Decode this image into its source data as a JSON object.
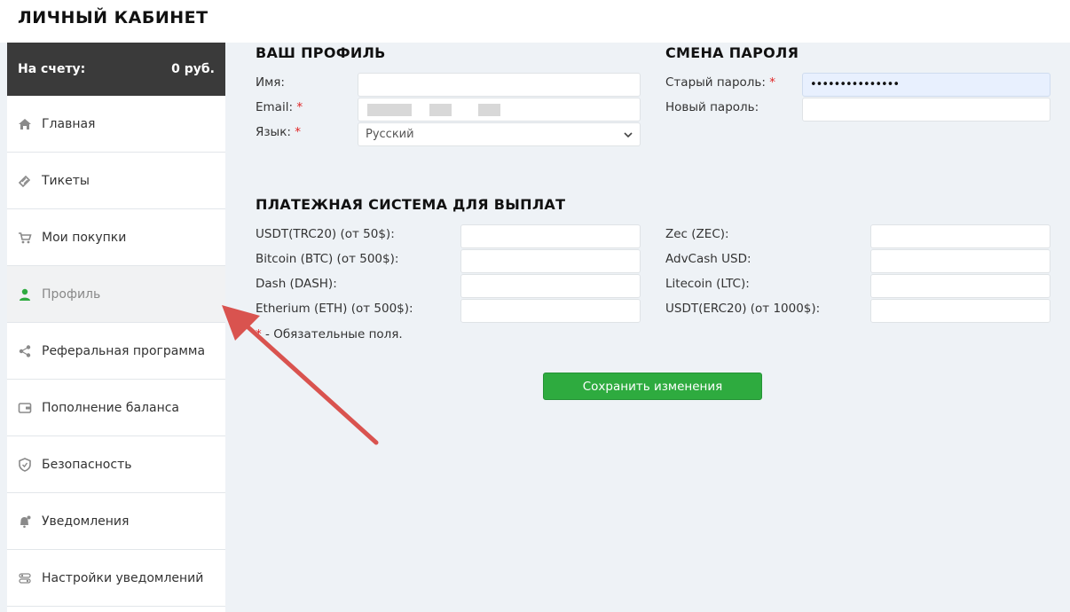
{
  "header": {
    "title": "ЛИЧНЫЙ КАБИНЕТ"
  },
  "balance": {
    "label": "На счету:",
    "value": "0 руб."
  },
  "sidebar": {
    "items": [
      {
        "label": "Главная",
        "icon": "home-icon"
      },
      {
        "label": "Тикеты",
        "icon": "ticket-icon"
      },
      {
        "label": "Мои покупки",
        "icon": "cart-icon"
      },
      {
        "label": "Профиль",
        "icon": "user-icon",
        "active": true
      },
      {
        "label": "Реферальная программа",
        "icon": "share-icon"
      },
      {
        "label": "Пополнение баланса",
        "icon": "wallet-icon"
      },
      {
        "label": "Безопасность",
        "icon": "shield-icon"
      },
      {
        "label": "Уведомления",
        "icon": "bell-icon"
      },
      {
        "label": "Настройки уведомлений",
        "icon": "settings-icon"
      }
    ]
  },
  "profile": {
    "title": "ВАШ ПРОФИЛЬ",
    "name_label": "Имя:",
    "name_value": "",
    "email_label": "Email:",
    "language_label": "Язык:",
    "language_value": "Русский"
  },
  "password": {
    "title": "СМЕНА ПАРОЛЯ",
    "old_label": "Старый пароль:",
    "old_value": "•••••••••••••••",
    "new_label": "Новый пароль:",
    "new_value": ""
  },
  "payment": {
    "title": "ПЛАТЕЖНАЯ СИСТЕМА ДЛЯ ВЫПЛАТ",
    "left": [
      "USDT(TRC20) (от 50$):",
      "Bitcoin (BTC) (от 500$):",
      "Dash (DASH):",
      "Etherium (ETH) (от 500$):"
    ],
    "right": [
      "Zec (ZEC):",
      "AdvCash USD:",
      "Litecoin (LTC):",
      "USDT(ERC20) (от 1000$):"
    ]
  },
  "required": {
    "star": "*",
    "note": " - Обязательные поля."
  },
  "save_label": "Сохранить изменения",
  "colors": {
    "accent": "#2eab3f",
    "user_icon": "#2eab3f",
    "required": "#e02525",
    "arrow": "#d9534f",
    "balance_bg": "#3a3a3a"
  }
}
